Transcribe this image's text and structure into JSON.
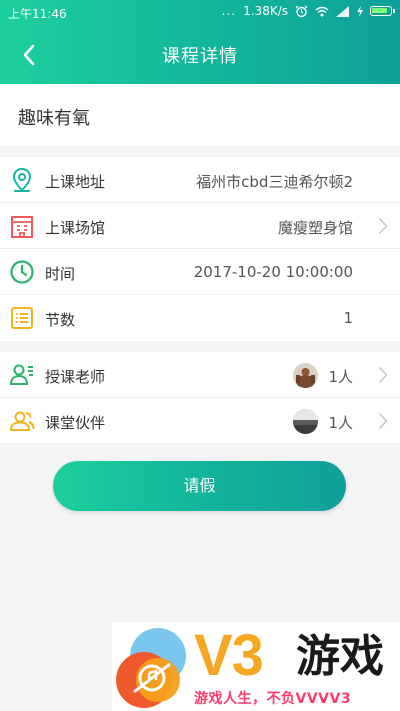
{
  "statusbar": {
    "time": "上午11:46",
    "dots": "...",
    "speed": "1.38K/s"
  },
  "nav": {
    "title": "课程详情"
  },
  "course": {
    "name": "趣味有氧"
  },
  "info_rows": [
    {
      "label": "上课地址",
      "value": "福州市cbd三迪希尔顿2",
      "icon": "location-pin-icon",
      "color": "#1ab3a6"
    },
    {
      "label": "上课场馆",
      "value": "魔瘦塑身馆",
      "icon": "building-icon",
      "color": "#f05a5a"
    },
    {
      "label": "时间",
      "value": "2017-10-20 10:00:00",
      "icon": "clock-icon",
      "color": "#2bb36b"
    },
    {
      "label": "节数",
      "value": "1",
      "icon": "list-icon",
      "color": "#f2b31c"
    }
  ],
  "people_rows": [
    {
      "label": "授课老师",
      "value": "1人",
      "icon": "teacher-icon",
      "color": "#2bb36b"
    },
    {
      "label": "课堂伙伴",
      "value": "1人",
      "icon": "partners-icon",
      "color": "#f2b31c"
    }
  ],
  "actions": {
    "leave_label": "请假"
  },
  "watermark": {
    "brand": "V3",
    "game": "游戏",
    "slogan": "游戏人生，不负VVVV3"
  },
  "colors": {
    "accent": "#13b59b",
    "watermark_orange": "#f5a623",
    "watermark_pink": "#ff3c6a"
  }
}
